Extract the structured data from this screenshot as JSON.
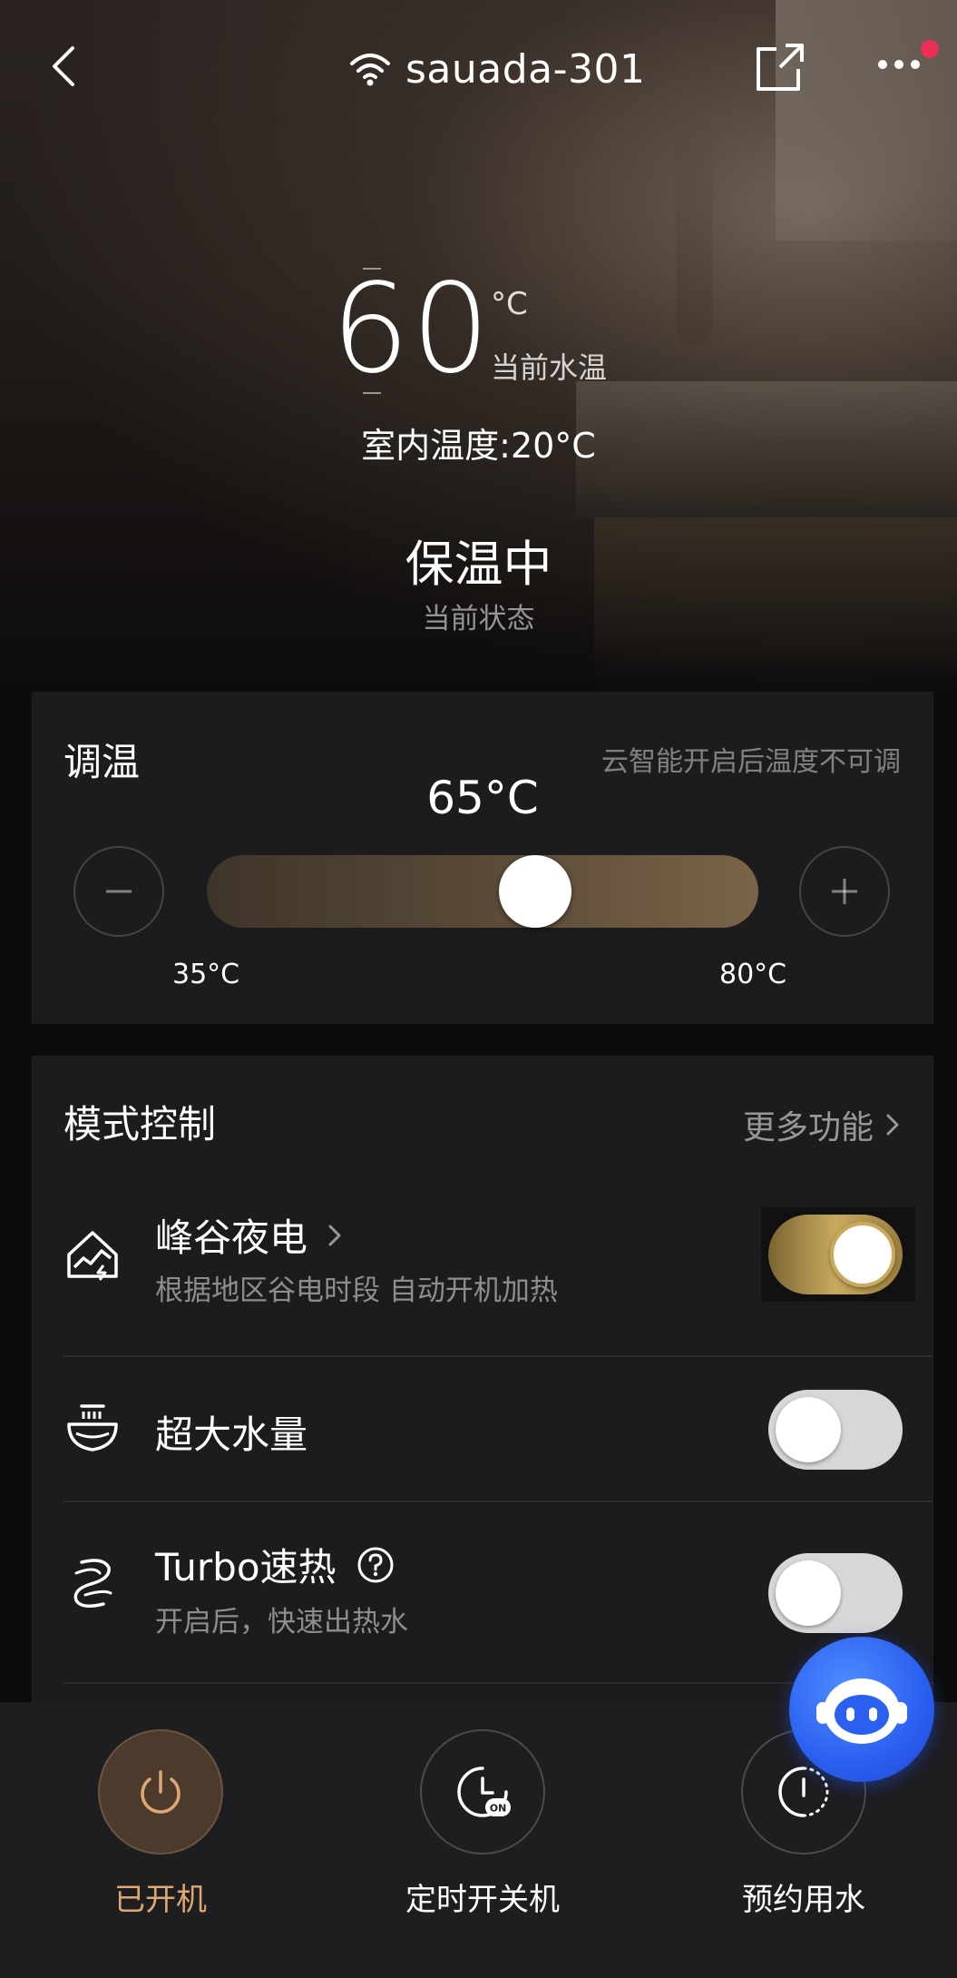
{
  "header": {
    "device_name": "sauada-301"
  },
  "display": {
    "current_temp": "60",
    "unit": "°C",
    "current_temp_caption": "当前水温",
    "room_temp": "室内温度:20°C",
    "status": "保温中",
    "status_caption": "当前状态"
  },
  "temp_control": {
    "title": "调温",
    "hint": "云智能开启后温度不可调",
    "set_value": "65°C",
    "min_label": "35°C",
    "max_label": "80°C",
    "min": 35,
    "max": 80,
    "value": 65
  },
  "mode_control": {
    "title": "模式控制",
    "more_label": "更多功能",
    "items": [
      {
        "title": "峰谷夜电",
        "subtitle": "根据地区谷电时段 自动开机加热",
        "icon": "valley-power-icon",
        "on": true
      },
      {
        "title": "超大水量",
        "subtitle": "",
        "icon": "large-water-icon",
        "on": false
      },
      {
        "title": "Turbo速热",
        "subtitle": "开启后，快速出热水",
        "icon": "turbo-icon",
        "on": false
      }
    ]
  },
  "bottom_bar": {
    "items": [
      {
        "label": "已开机",
        "icon": "power-icon",
        "active": true
      },
      {
        "label": "定时开关机",
        "icon": "timer-on-icon",
        "active": false
      },
      {
        "label": "预约用水",
        "icon": "schedule-icon",
        "active": false
      }
    ]
  },
  "colors": {
    "accent_gold": "#c8aa5e",
    "active_label": "#dfa872",
    "notification_dot": "#ee2f55",
    "assistant_blue": "#2a5ff0"
  }
}
